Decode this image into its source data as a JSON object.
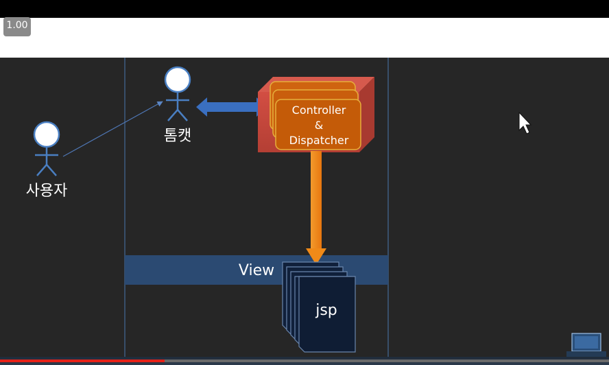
{
  "player": {
    "speed_badge": "1.00",
    "progress_fraction": 0.27
  },
  "diagram": {
    "user_label": "사용자",
    "tomcat_label": "톰캣",
    "controller_line1": "Controller",
    "controller_line2": "&",
    "controller_line3": "Dispatcher",
    "view_label": "View",
    "jsp_label": "jsp"
  },
  "colors": {
    "slide_background": "#262626",
    "actor_stroke": "#4a7fc2",
    "controller_fill": "#c85b08",
    "container_fill": "#c4493d",
    "view_band": "#2b4a72",
    "arrow_orange": "#f08a18",
    "progress_red": "#e62117"
  }
}
